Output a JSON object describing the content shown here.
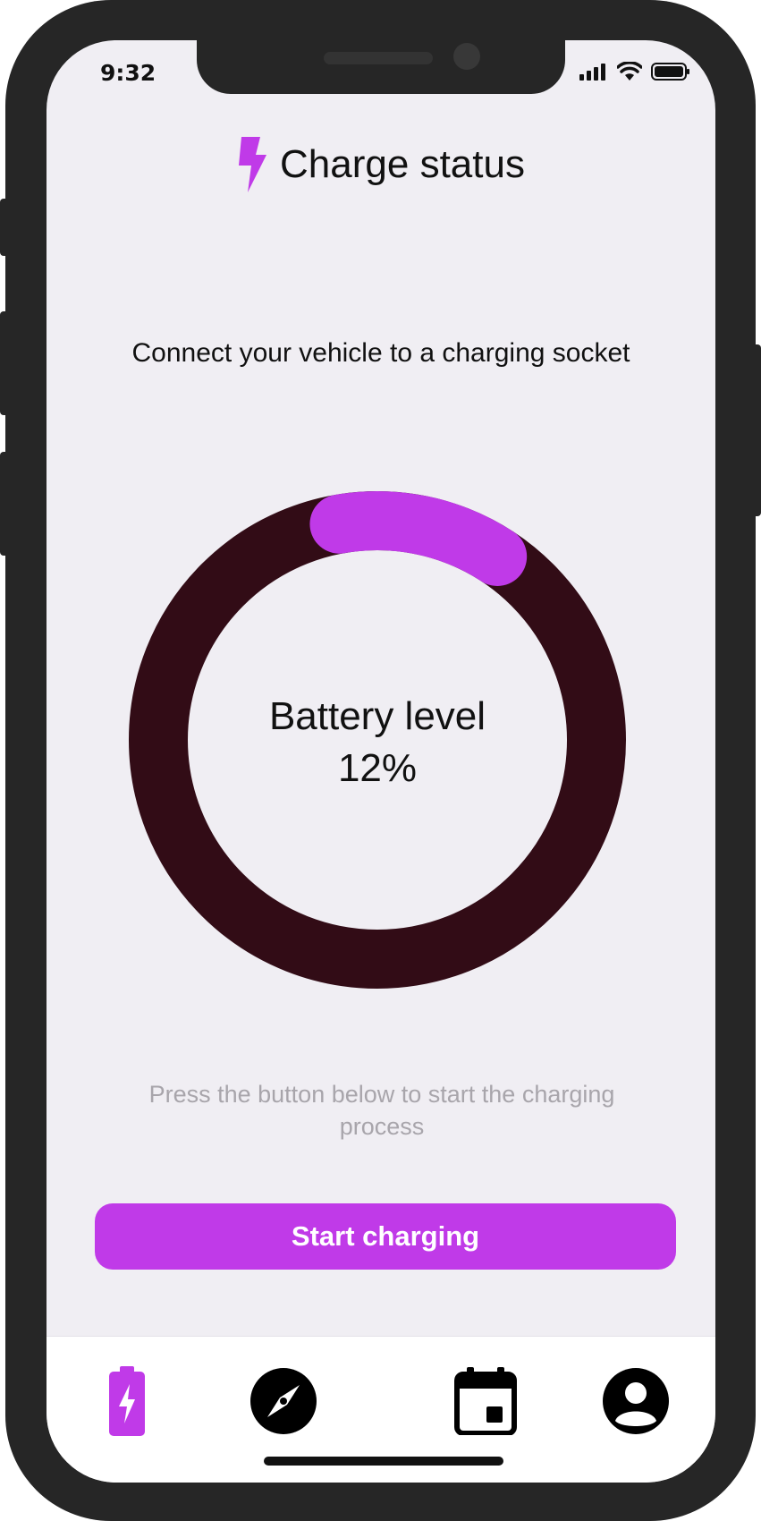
{
  "status_bar": {
    "time": "9:32",
    "icons": [
      "signal-icon",
      "wifi-icon",
      "battery-icon"
    ]
  },
  "header": {
    "icon": "lightning-bolt-icon",
    "title": "Charge status"
  },
  "instruction": "Connect your vehicle to a charging socket",
  "battery": {
    "label": "Battery level",
    "value_text": "12%",
    "level_fraction": 0.12
  },
  "hint": "Press the button below to start the charging process",
  "primary_button": {
    "label": "Start charging"
  },
  "tab_bar": {
    "items": [
      {
        "name": "charge",
        "icon": "battery-charging-icon",
        "active": true
      },
      {
        "name": "explore",
        "icon": "compass-icon",
        "active": false
      },
      {
        "name": "calendar",
        "icon": "calendar-icon",
        "active": false
      },
      {
        "name": "profile",
        "icon": "account-circle-icon",
        "active": false
      }
    ]
  },
  "colors": {
    "accent": "#c03ae8",
    "ring_track": "#320c16",
    "background": "#f0eef3",
    "device_frame": "#262626",
    "hint_text": "#a8a5ab"
  }
}
